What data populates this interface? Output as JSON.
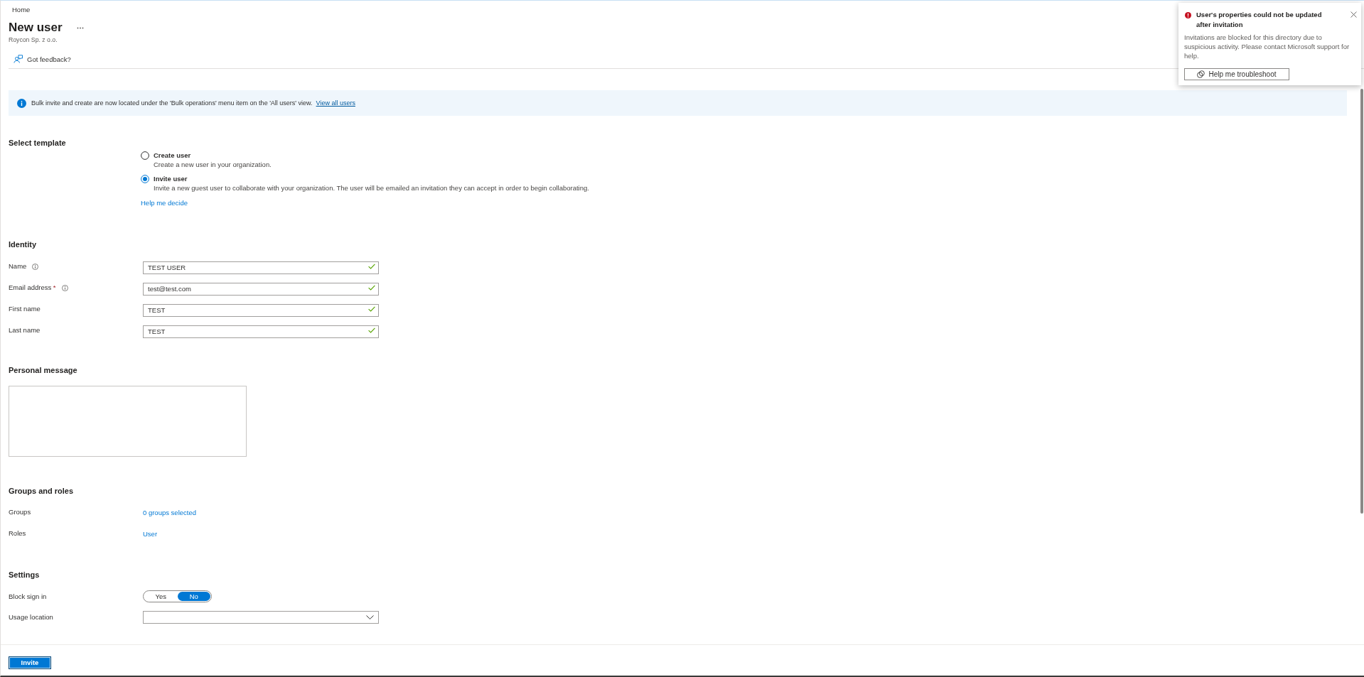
{
  "breadcrumb": {
    "items": [
      "Home"
    ]
  },
  "header": {
    "title": "New user",
    "subtitle": "Roycon Sp. z o.o."
  },
  "toolbar": {
    "feedback": "Got feedback?"
  },
  "info_banner": {
    "text": "Bulk invite and create are now located under the 'Bulk operations' menu item on the 'All users' view.",
    "link": "View all users"
  },
  "select_template": {
    "heading": "Select template",
    "options": [
      {
        "label": "Create user",
        "description": "Create a new user in your organization.",
        "selected": false
      },
      {
        "label": "Invite user",
        "description": "Invite a new guest user to collaborate with your organization. The user will be emailed an invitation they can accept in order to begin collaborating.",
        "selected": true
      }
    ],
    "help_link": "Help me decide"
  },
  "identity": {
    "heading": "Identity",
    "fields": [
      {
        "label": "Name",
        "info": true,
        "value": "TEST USER",
        "valid": true
      },
      {
        "label": "Email address",
        "required_mark": "*",
        "info": true,
        "value": "test@test.com",
        "valid": true
      },
      {
        "label": "First name",
        "info": false,
        "value": "TEST",
        "valid": true
      },
      {
        "label": "Last name",
        "info": false,
        "value": "TEST",
        "valid": true
      }
    ]
  },
  "personal_message": {
    "heading": "Personal message"
  },
  "groups_and_roles": {
    "heading": "Groups and roles",
    "rows": [
      {
        "label": "Groups",
        "value": "0 groups selected"
      },
      {
        "label": "Roles",
        "value": "User"
      }
    ]
  },
  "settings": {
    "heading": "Settings",
    "block_sign_in": {
      "label": "Block sign in",
      "options": [
        {
          "label": "Yes",
          "selected": false
        },
        {
          "label": "No",
          "selected": true
        }
      ]
    },
    "usage_location": {
      "label": "Usage location"
    }
  },
  "footer": {
    "button": "Invite"
  },
  "notification": {
    "title": "User's properties could not be updated after invitation",
    "message": "Invitations are blocked for this directory due to suspicious activity. Please contact Microsoft support for help.",
    "button": "Help me troubleshoot"
  }
}
